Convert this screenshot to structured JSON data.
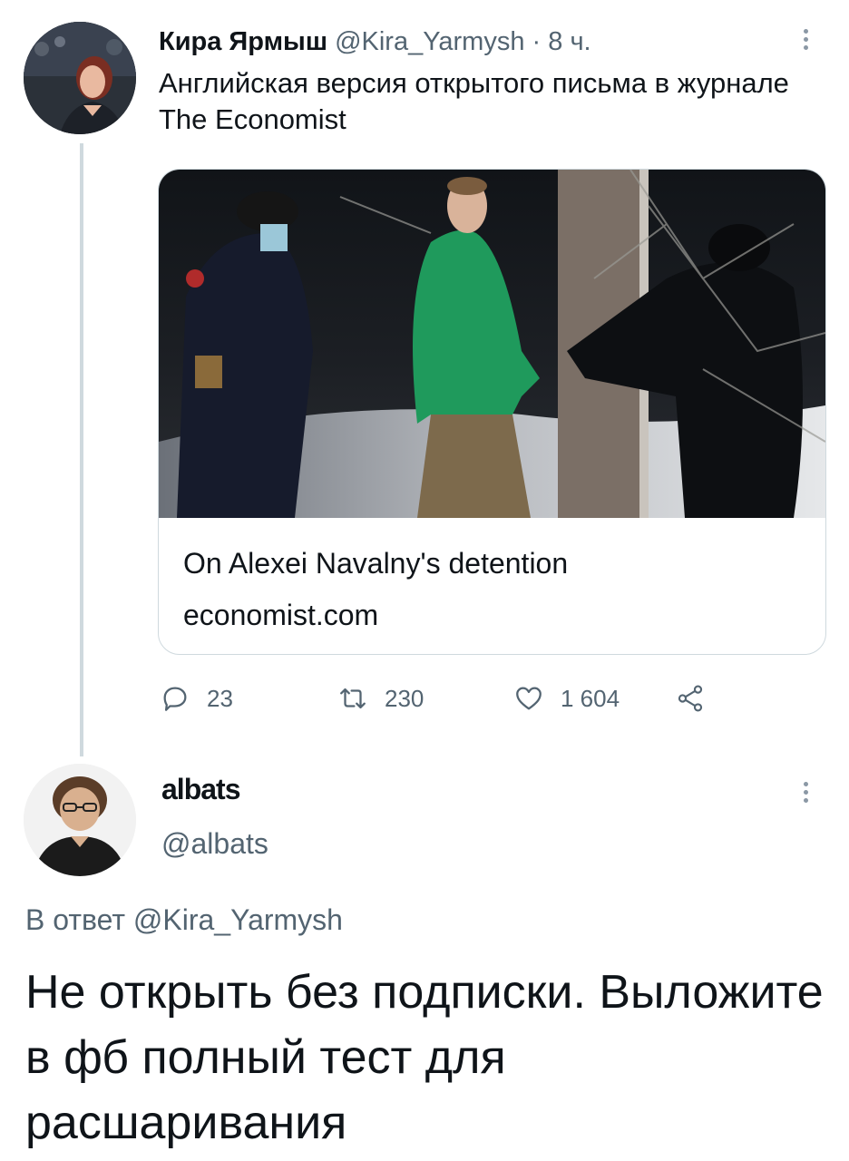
{
  "tweet1": {
    "author_name": "Кира Ярмыш",
    "handle": "@Kira_Yarmysh",
    "separator": "·",
    "time": "8 ч.",
    "text": "Английская версия открытого письма в журнале The Economist",
    "card": {
      "title": "On Alexei Navalny's detention",
      "domain": "economist.com"
    },
    "actions": {
      "replies": "23",
      "retweets": "230",
      "likes": "1 604"
    }
  },
  "tweet2": {
    "author_name": "albats",
    "handle": "@albats",
    "reply_prefix": "В ответ",
    "reply_to": "@Kira_Yarmysh",
    "text": "Не открыть без подписки. Выложите в фб полный тест для расшаривания"
  },
  "icons": {
    "reply": "reply-icon",
    "retweet": "retweet-icon",
    "like": "heart-icon",
    "share": "share-icon",
    "more": "more-vertical-icon"
  },
  "colors": {
    "text_primary": "#0f1419",
    "text_secondary": "#536471",
    "thread_line": "#cfd9de",
    "jacket_green": "#1f9a5c"
  }
}
